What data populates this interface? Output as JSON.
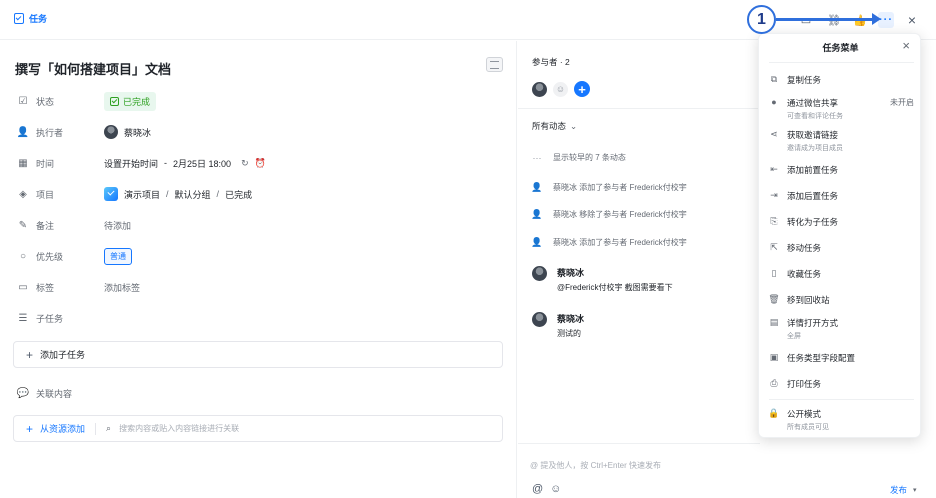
{
  "header": {
    "brand_label": "任务"
  },
  "task": {
    "title": "撰写「如何搭建项目」文档",
    "fields": {
      "status_label": "状态",
      "status_value": "已完成",
      "assignee_label": "执行者",
      "assignee_value": "蔡晓冰",
      "time_label": "时间",
      "time_start": "设置开始时间",
      "time_dash": "-",
      "time_end": "2月25日 18:00",
      "project_label": "项目",
      "project_name": "演示项目",
      "project_slash1": "/",
      "project_group": "默认分组",
      "project_slash2": "/",
      "project_state": "已完成",
      "note_label": "备注",
      "note_value": "待添加",
      "priority_label": "优先级",
      "priority_value": "普通",
      "tags_label": "标签",
      "tags_value": "添加标签",
      "subtask_label": "子任务"
    },
    "add_subtask": "添加子任务",
    "related_label": "关联内容",
    "add_from_resource": "从资源添加",
    "search_placeholder": "搜索内容或贴入内容链接进行关联"
  },
  "activity": {
    "participants_label": "参与者 · 2",
    "filter_label": "所有动态",
    "show_earlier": "显示较早的 7 条动态",
    "events": [
      "蔡晓冰 添加了参与者 Frederick付校宇",
      "蔡晓冰 移除了参与者 Frederick付校宇",
      "蔡晓冰 添加了参与者 Frederick付校宇"
    ],
    "comments": [
      {
        "name": "蔡晓冰",
        "body": "@Frederick付校宇 截图需要看下"
      },
      {
        "name": "蔡晓冰",
        "body": "测试的"
      }
    ],
    "input_placeholder": "@ 提及他人，按 Ctrl+Enter 快速发布",
    "publish_label": "发布"
  },
  "menu": {
    "title": "任务菜单",
    "items": [
      {
        "label": "复制任务",
        "icon": "copy-icon"
      },
      {
        "label": "通过微信共享",
        "sub": "可查看和评论任务",
        "right": "未开启",
        "icon": "wechat-icon"
      },
      {
        "label": "获取邀请链接",
        "sub": "邀请成为项目成员",
        "icon": "share-icon"
      },
      {
        "label": "添加前置任务",
        "icon": "predecessor-icon"
      },
      {
        "label": "添加后置任务",
        "icon": "successor-icon"
      },
      {
        "label": "转化为子任务",
        "icon": "convert-icon"
      },
      {
        "label": "移动任务",
        "icon": "move-icon"
      },
      {
        "label": "收藏任务",
        "icon": "bookmark-icon"
      },
      {
        "label": "移到回收站",
        "icon": "trash-icon"
      },
      {
        "label": "详情打开方式",
        "sub": "全屏",
        "icon": "layout-icon"
      },
      {
        "label": "任务类型字段配置",
        "icon": "field-config-icon"
      },
      {
        "label": "打印任务",
        "icon": "print-icon"
      },
      {
        "label": "公开模式",
        "sub": "所有成员可见",
        "icon": "lock-icon"
      }
    ]
  },
  "annotation": {
    "callout_number": "1"
  },
  "colors": {
    "accent": "#1677ff",
    "success": "#2ea121",
    "callout": "#2f6fdc"
  }
}
